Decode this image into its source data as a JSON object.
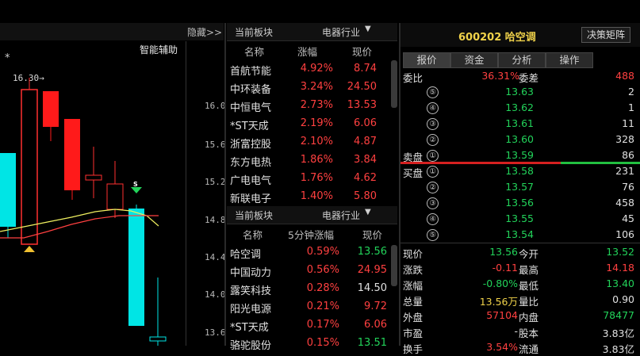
{
  "chart": {
    "label": "智能辅助",
    "hide_label": "隐藏>>",
    "star": "*",
    "high_marker": "16.30→",
    "buy_marker": "B",
    "sell_marker": "S",
    "price_ticks": [
      "16.0",
      "15.6",
      "15.2",
      "14.8",
      "14.4",
      "14.0",
      "13.6"
    ]
  },
  "sector_panel_1": {
    "title": "当前板块",
    "sector": "电器行业",
    "headers": {
      "name": "名称",
      "change": "涨幅",
      "price": "现价"
    },
    "rows": [
      {
        "name": "首航节能",
        "change": "4.92%",
        "price": "8.74"
      },
      {
        "name": "中环装备",
        "change": "3.24%",
        "price": "24.50"
      },
      {
        "name": "中恒电气",
        "change": "2.73%",
        "price": "13.53"
      },
      {
        "name": "*ST天成",
        "change": "2.19%",
        "price": "6.06"
      },
      {
        "name": "浙富控股",
        "change": "2.10%",
        "price": "4.87"
      },
      {
        "name": "东方电热",
        "change": "1.86%",
        "price": "3.84"
      },
      {
        "name": "广电电气",
        "change": "1.76%",
        "price": "4.62"
      },
      {
        "name": "新联电子",
        "change": "1.40%",
        "price": "5.80"
      }
    ]
  },
  "sector_panel_2": {
    "title": "当前板块",
    "sector": "电器行业",
    "headers": {
      "name": "名称",
      "change": "5分钟涨幅",
      "price": "现价"
    },
    "rows": [
      {
        "name": "哈空调",
        "change": "0.59%",
        "price": "13.56"
      },
      {
        "name": "中国动力",
        "change": "0.56%",
        "price": "24.95"
      },
      {
        "name": "露笑科技",
        "change": "0.28%",
        "price": "14.50"
      },
      {
        "name": "阳光电源",
        "change": "0.21%",
        "price": "9.72"
      },
      {
        "name": "*ST天成",
        "change": "0.17%",
        "price": "6.06"
      },
      {
        "name": "骆驼股份",
        "change": "0.15%",
        "price": "13.51"
      }
    ]
  },
  "quote": {
    "code_name": "600202 哈空调",
    "decision_button": "决策矩阵",
    "tabs": [
      "报价",
      "资金",
      "分析",
      "操作"
    ],
    "weibi_label": "委比",
    "weibi_value": "36.31%",
    "weicha_label": "委差",
    "weicha_value": "488",
    "sell": [
      {
        "level": "⑤",
        "price": "13.63",
        "vol": "2"
      },
      {
        "level": "④",
        "price": "13.62",
        "vol": "1"
      },
      {
        "level": "③",
        "price": "13.61",
        "vol": "11"
      },
      {
        "level": "②",
        "price": "13.60",
        "vol": "328"
      },
      {
        "level": "①",
        "price": "13.59",
        "vol": "86"
      }
    ],
    "sell_label": "卖盘",
    "buy_label": "买盘",
    "buy": [
      {
        "level": "①",
        "price": "13.58",
        "vol": "231"
      },
      {
        "level": "②",
        "price": "13.57",
        "vol": "76"
      },
      {
        "level": "③",
        "price": "13.56",
        "vol": "458"
      },
      {
        "level": "④",
        "price": "13.55",
        "vol": "45"
      },
      {
        "level": "⑤",
        "price": "13.54",
        "vol": "106"
      }
    ],
    "stats": [
      {
        "l1": "现价",
        "v1": "13.56",
        "l2": "今开",
        "v2": "13.52"
      },
      {
        "l1": "涨跌",
        "v1": "-0.11",
        "l2": "最高",
        "v2": "14.18"
      },
      {
        "l1": "涨幅",
        "v1": "-0.80%",
        "l2": "最低",
        "v2": "13.40"
      },
      {
        "l1": "总量",
        "v1": "13.56万",
        "l2": "量比",
        "v2": "0.90"
      },
      {
        "l1": "外盘",
        "v1": "57104",
        "l2": "内盘",
        "v2": "78477"
      },
      {
        "l1": "市盈",
        "v1": "-",
        "l2": "股本",
        "v2": "3.83亿"
      }
    ],
    "bottom_partial": {
      "l1": "换手",
      "v1": "3.54%",
      "l2": "流通",
      "v2": "3.83亿"
    }
  }
}
